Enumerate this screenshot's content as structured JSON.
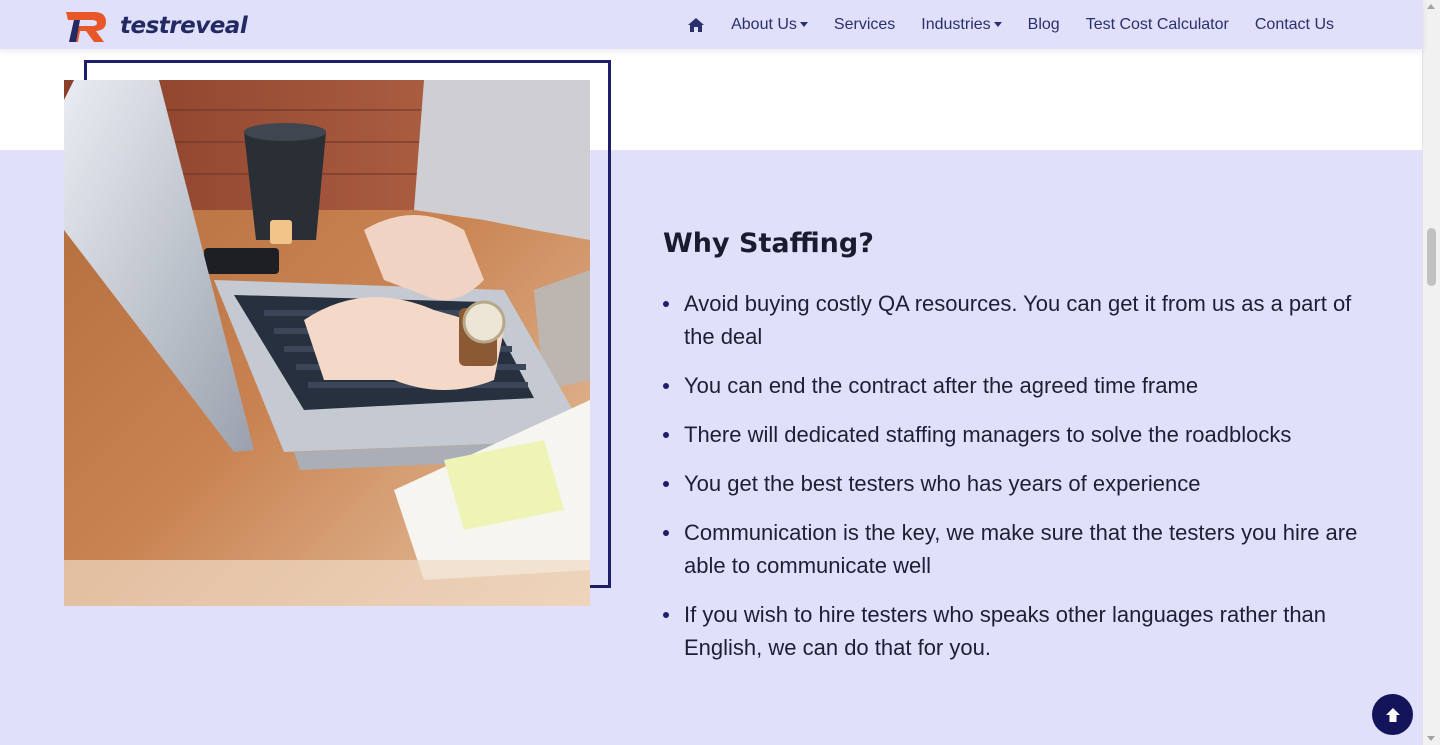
{
  "navbar": {
    "brand_text": "testreveal",
    "home_icon": "home-icon",
    "items": [
      {
        "label": "About Us",
        "dropdown": true
      },
      {
        "label": "Services",
        "dropdown": false
      },
      {
        "label": "Industries",
        "dropdown": true
      },
      {
        "label": "Blog",
        "dropdown": false
      },
      {
        "label": "Test Cost Calculator",
        "dropdown": false
      },
      {
        "label": "Contact Us",
        "dropdown": false
      }
    ]
  },
  "section": {
    "heading": "Why Staffing?",
    "bullets": [
      "Avoid buying costly QA resources. You can get it from us as a part of the deal",
      "You can end the contract after the agreed time frame",
      "There will dedicated staffing managers to solve the roadblocks",
      "You get the best testers who has years of experience",
      "Communication is the key, we make sure that the testers you hire are able to communicate well",
      "If you wish to hire testers who speaks other languages rather than English, we can do that for you."
    ]
  },
  "back_to_top": {
    "icon": "arrow-up-icon"
  },
  "colors": {
    "band": "#e0e0fb",
    "navy": "#1e1e6b",
    "brand_orange": "#e8572a",
    "text": "#1f1f33"
  }
}
